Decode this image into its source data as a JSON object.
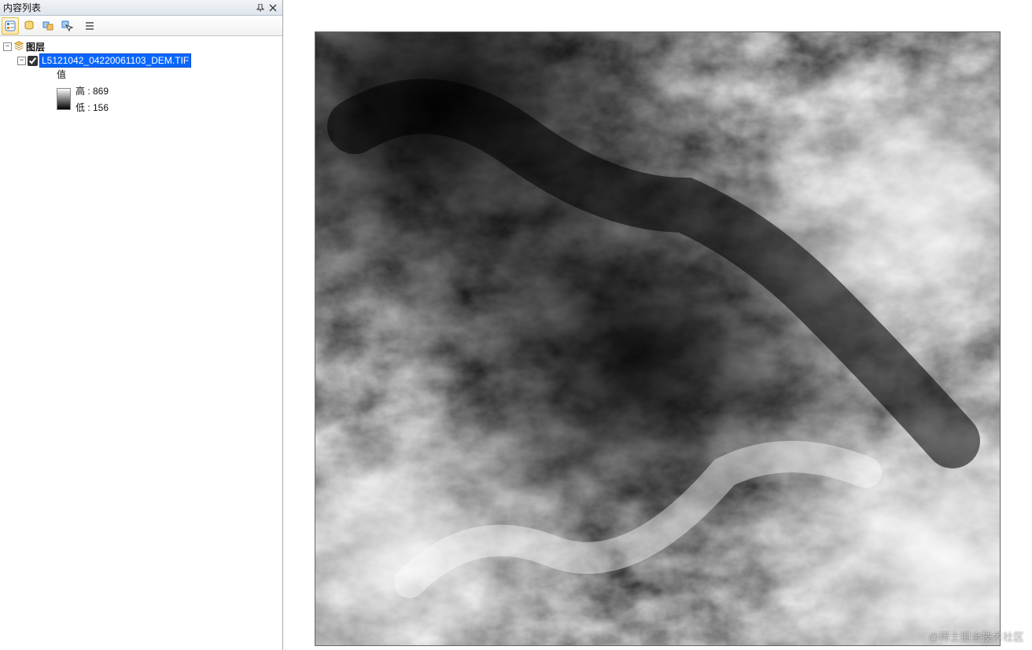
{
  "sidebar": {
    "title": "内容列表",
    "toolbar_icons": [
      "list-by-drawing-order-icon",
      "list-by-source-icon",
      "list-by-visibility-icon",
      "list-by-selection-icon",
      "options-icon"
    ],
    "root": {
      "label": "图层"
    },
    "layer": {
      "name": "L5121042_04220061103_DEM.TIF",
      "checked": true,
      "legend": {
        "title": "值",
        "high_label": "高 : 869",
        "low_label": "低 : 156"
      }
    }
  },
  "watermark": "@稀土掘金技术社区"
}
